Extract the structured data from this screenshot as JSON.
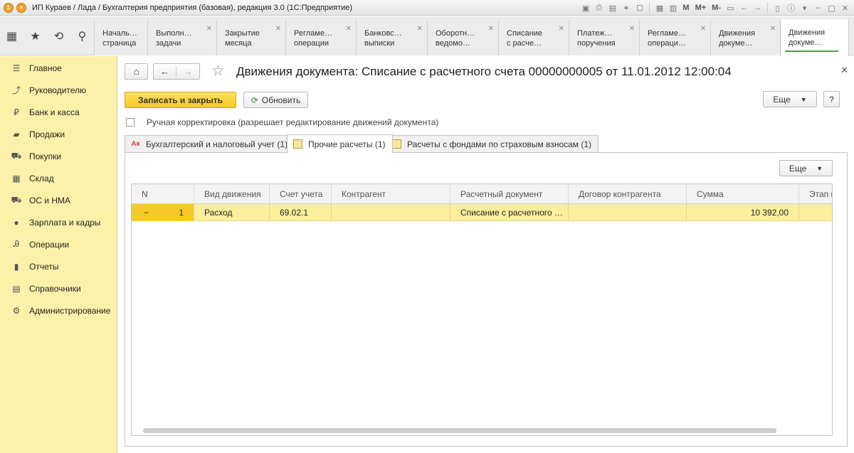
{
  "window": {
    "title": "ИП Кураев / Лада / Бухгалтерия предприятия (базовая), редакция 3.0  (1С:Предприятие)",
    "toolbar_m": "M",
    "toolbar_mplus": "M+",
    "toolbar_mminus": "M-"
  },
  "tabs": [
    {
      "label": "Началь…\nстраница",
      "closable": false
    },
    {
      "label": "Выполн…\nзадачи",
      "closable": true
    },
    {
      "label": "Закрытие\nмесяца",
      "closable": true
    },
    {
      "label": "Регламе…\nоперации",
      "closable": true
    },
    {
      "label": "Банковс…\nвыписки",
      "closable": true
    },
    {
      "label": "Оборотн…\nведомо…",
      "closable": true
    },
    {
      "label": "Списание\nс расче…",
      "closable": true
    },
    {
      "label": "Платеж…\nпоручения",
      "closable": true
    },
    {
      "label": "Регламе…\nопераци…",
      "closable": true
    },
    {
      "label": "Движения\nдокуме…",
      "closable": true
    },
    {
      "label": "Движения\nдокуме…",
      "closable": false,
      "active": true
    }
  ],
  "sidebar": {
    "items": [
      {
        "label": "Главное",
        "icon": "menu-icon"
      },
      {
        "label": "Руководителю",
        "icon": "trend-icon"
      },
      {
        "label": "Банк и касса",
        "icon": "ruble-icon"
      },
      {
        "label": "Продажи",
        "icon": "bag-icon"
      },
      {
        "label": "Покупки",
        "icon": "cart-icon"
      },
      {
        "label": "Склад",
        "icon": "warehouse-icon"
      },
      {
        "label": "ОС и НМА",
        "icon": "truck-icon"
      },
      {
        "label": "Зарплата и кадры",
        "icon": "person-icon"
      },
      {
        "label": "Операции",
        "icon": "ledger-icon"
      },
      {
        "label": "Отчеты",
        "icon": "bar-chart-icon"
      },
      {
        "label": "Справочники",
        "icon": "book-icon"
      },
      {
        "label": "Администрирование",
        "icon": "gear-icon"
      }
    ]
  },
  "document": {
    "title": "Движения документа: Списание с расчетного счета 00000000005 от 11.01.2012 12:00:04",
    "save_close_label": "Записать и закрыть",
    "refresh_label": "Обновить",
    "more_label": "Еще",
    "help_label": "?",
    "manual_edit_label": "Ручная корректировка (разрешает редактирование движений документа)",
    "manual_edit_checked": false
  },
  "inner_tabs": [
    {
      "label": "Бухгалтерский и налоговый учет (1)",
      "icon": "accounting-icon"
    },
    {
      "label": "Прочие расчеты (1)",
      "icon": "register-icon",
      "active": true
    },
    {
      "label": "Расчеты с фондами по страховым взносам (1)",
      "icon": "register-icon"
    }
  ],
  "table": {
    "more_label": "Еще",
    "columns": [
      "N",
      "Вид движения",
      "Счет учета",
      "Контрагент",
      "Расчетный документ",
      "Договор контрагента",
      "Сумма",
      "Этап п"
    ],
    "rows": [
      {
        "sign": "−",
        "n": "1",
        "movement": "Расход",
        "account": "69.02.1",
        "counterparty": "",
        "document": "Списание с расчетного …",
        "contract": "",
        "amount": "10 392,00",
        "stage": ""
      }
    ]
  }
}
